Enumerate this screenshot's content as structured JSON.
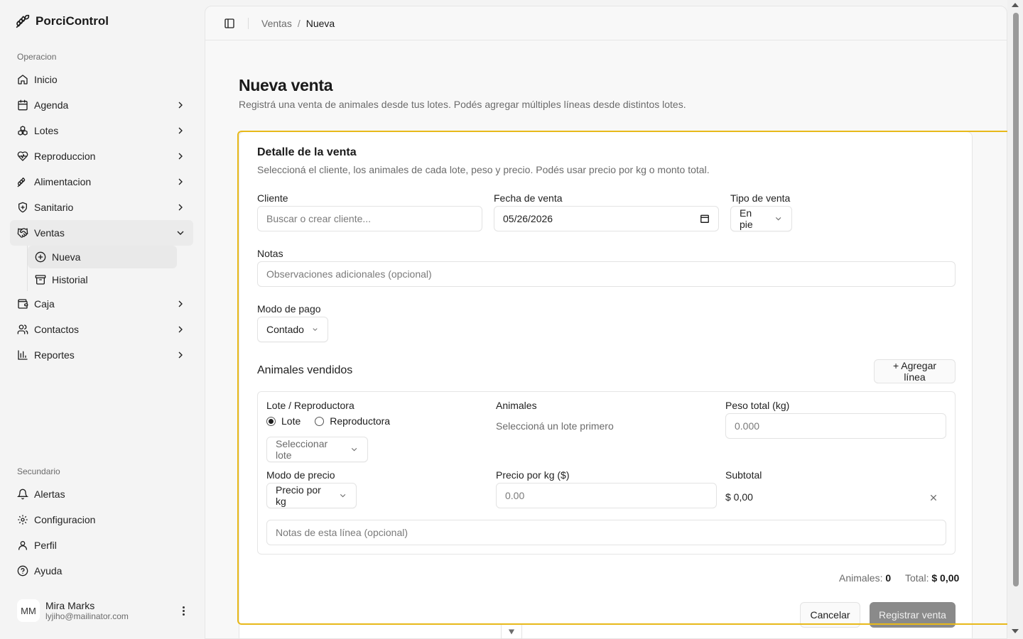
{
  "app": {
    "name": "PorciControl"
  },
  "sidebar": {
    "section_operacion": "Operacion",
    "items": [
      {
        "label": "Inicio",
        "icon": "home-icon"
      },
      {
        "label": "Agenda",
        "icon": "calendar-icon"
      },
      {
        "label": "Lotes",
        "icon": "boxes-icon"
      },
      {
        "label": "Reproduccion",
        "icon": "heart-pulse-icon"
      },
      {
        "label": "Alimentacion",
        "icon": "wheat-icon"
      },
      {
        "label": "Sanitario",
        "icon": "shield-plus-icon"
      },
      {
        "label": "Ventas",
        "icon": "handshake-icon"
      },
      {
        "label": "Caja",
        "icon": "wallet-icon"
      },
      {
        "label": "Contactos",
        "icon": "users-icon"
      },
      {
        "label": "Reportes",
        "icon": "bar-chart-icon"
      }
    ],
    "ventas_sub": [
      {
        "label": "Nueva",
        "icon": "plus-circle-icon"
      },
      {
        "label": "Historial",
        "icon": "archive-icon"
      }
    ],
    "section_secundario": "Secundario",
    "secondary": [
      {
        "label": "Alertas",
        "icon": "bell-icon"
      },
      {
        "label": "Configuracion",
        "icon": "gear-icon"
      },
      {
        "label": "Perfil",
        "icon": "user-icon"
      },
      {
        "label": "Ayuda",
        "icon": "help-circle-icon"
      }
    ],
    "user": {
      "initials": "MM",
      "name": "Mira Marks",
      "email": "lyjiho@mailinator.com"
    }
  },
  "breadcrumb": {
    "parent": "Ventas",
    "sep": "/",
    "current": "Nueva"
  },
  "page": {
    "title": "Nueva venta",
    "subtitle": "Registrá una venta de animales desde tus lotes. Podés agregar múltiples líneas desde distintos lotes."
  },
  "form": {
    "title": "Detalle de la venta",
    "subtitle": "Seleccioná el cliente, los animales de cada lote, peso y precio. Podés usar precio por kg o monto total.",
    "cliente_label": "Cliente",
    "cliente_placeholder": "Buscar o crear cliente...",
    "fecha_label": "Fecha de venta",
    "fecha_value": "05/26/2026",
    "tipo_label": "Tipo de venta",
    "tipo_value": "En pie",
    "notas_label": "Notas",
    "notas_placeholder": "Observaciones adicionales (opcional)",
    "pago_label": "Modo de pago",
    "pago_value": "Contado",
    "animales_title": "Animales vendidos",
    "agregar_label": "+ Agregar línea",
    "line": {
      "lote_label": "Lote / Reproductora",
      "radio_lote": "Lote",
      "radio_repro": "Reproductora",
      "lote_select": "Seleccionar lote",
      "animales_label": "Animales",
      "animales_hint": "Seleccioná un lote primero",
      "peso_label": "Peso total (kg)",
      "peso_placeholder": "0.000",
      "modo_precio_label": "Modo de precio",
      "modo_precio_value": "Precio por kg",
      "precio_kg_label": "Precio por kg ($)",
      "precio_kg_placeholder": "0.00",
      "subtotal_label": "Subtotal",
      "subtotal_value": "$ 0,00",
      "notas_placeholder": "Notas de esta línea (opcional)"
    },
    "totals": {
      "animales_label": "Animales:",
      "animales_value": "0",
      "total_label": "Total:",
      "total_value": "$ 0,00"
    },
    "cancel_label": "Cancelar",
    "submit_label": "Registrar venta"
  },
  "colors": {
    "highlight": "#e8b91a",
    "submit_disabled": "#8a8a8a"
  }
}
